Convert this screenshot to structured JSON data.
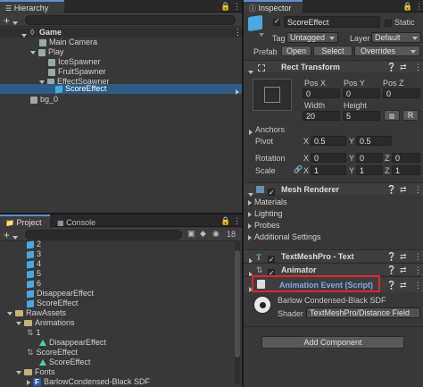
{
  "hierarchy": {
    "tab": "Hierarchy",
    "tree": {
      "scene": "Game",
      "main_camera": "Main Camera",
      "play": "Play",
      "ice": "IceSpawner",
      "fruit": "FruitSpawner",
      "effect": "EffectSpawner",
      "score": "ScoreEffect",
      "bg": "bg_0"
    }
  },
  "project": {
    "tabs": [
      "Project",
      "Console"
    ],
    "badge": "18",
    "items": {
      "n2": "2",
      "n3": "3",
      "n4": "4",
      "n5": "5",
      "n6": "6",
      "disappear": "DisappearEffect",
      "score": "ScoreEffect",
      "raw": "RawAssets",
      "animations": "Animations",
      "one": "1",
      "disappear2": "DisappearEffect",
      "score2": "ScoreEffect",
      "score3": "ScoreEffect",
      "fonts": "Fonts",
      "font": "BarlowCondensed-Black SDF"
    }
  },
  "inspector": {
    "tab": "Inspector",
    "name": "ScoreEffect",
    "static": "Static",
    "tag_label": "Tag",
    "tag_value": "Untagged",
    "layer_label": "Layer",
    "layer_value": "Default",
    "prefab_label": "Prefab",
    "prefab_open": "Open",
    "prefab_select": "Select",
    "prefab_overrides": "Overrides",
    "rect": {
      "title": "Rect Transform",
      "posx": "Pos X",
      "posy": "Pos Y",
      "posz": "Pos Z",
      "posx_v": "0",
      "posy_v": "0",
      "posz_v": "0",
      "width": "Width",
      "height": "Height",
      "width_v": "20",
      "height_v": "5",
      "r_btn": "R",
      "anchors": "Anchors",
      "pivot": "Pivot",
      "pivot_x": "0.5",
      "pivot_y": "0.5",
      "rotation": "Rotation",
      "rot_x": "0",
      "rot_y": "0",
      "rot_z": "0",
      "scale": "Scale",
      "scale_x": "1",
      "scale_y": "1",
      "scale_z": "1",
      "x": "X",
      "y": "Y",
      "z": "Z"
    },
    "mesh": {
      "title": "Mesh Renderer",
      "materials": "Materials",
      "lighting": "Lighting",
      "probes": "Probes",
      "additional": "Additional Settings"
    },
    "tmp": {
      "title": "TextMeshPro - Text"
    },
    "animator": {
      "title": "Animator"
    },
    "anim_event": {
      "title": "Animation Event (Script)"
    },
    "material": {
      "name": "Barlow Condensed-Black SDF",
      "shader_label": "Shader",
      "shader_value": "TextMeshPro/Distance Field"
    },
    "add_component": "Add Component"
  },
  "colors": {
    "highlight": "#e0262a",
    "selection": "#2c5d87",
    "accent": "#5a8fd6"
  }
}
